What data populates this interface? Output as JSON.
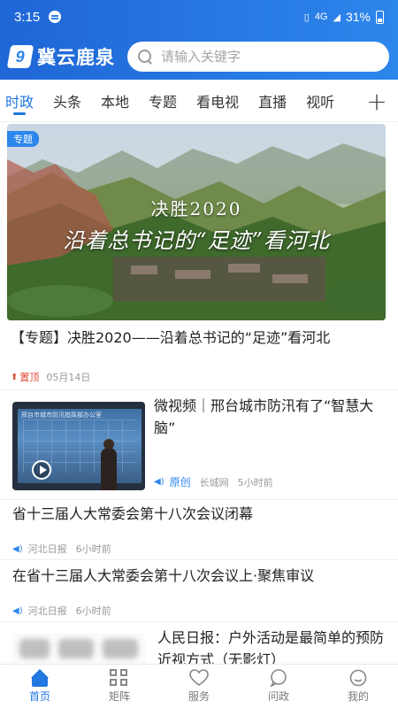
{
  "status_bar": {
    "time": "3:15",
    "network": "4G",
    "battery": "31%"
  },
  "header": {
    "logo_glyph": "9",
    "brand": "冀云鹿泉",
    "search_placeholder": "请输入关键字"
  },
  "tabs": [
    {
      "label": "时政",
      "active": true
    },
    {
      "label": "头条"
    },
    {
      "label": "本地"
    },
    {
      "label": "专题"
    },
    {
      "label": "看电视"
    },
    {
      "label": "直播"
    },
    {
      "label": "视听"
    }
  ],
  "tab_add_label": "+",
  "featured": {
    "badge": "专题",
    "overlay_line1": "决胜2020",
    "overlay_line2": "沿着总书记的“足迹”看河北",
    "title": "【专题】决胜2020——沿着总书记的“足迹”看河北",
    "pin_label": "置顶",
    "date": "05月14日"
  },
  "news": [
    {
      "title": "微视频｜邢台城市防汛有了“智慧大脑”",
      "original_label": "原创",
      "source": "长城网",
      "time": "5小时前",
      "thumb_caption": "邢台市城市防汛指挥部办公室"
    },
    {
      "title": "省十三届人大常委会第十八次会议闭幕",
      "source": "河北日报",
      "time": "6小时前"
    },
    {
      "title": "在省十三届人大常委会第十八次会议上·聚焦审议",
      "source": "河北日报",
      "time": "6小时前"
    },
    {
      "title": "人民日报：户外活动是最简单的预防近视方式（无影灯）"
    }
  ],
  "bottom_nav": [
    {
      "label": "首页",
      "icon": "home-icon",
      "active": true
    },
    {
      "label": "矩阵",
      "icon": "grid-icon"
    },
    {
      "label": "服务",
      "icon": "heart-icon"
    },
    {
      "label": "问政",
      "icon": "chat-icon"
    },
    {
      "label": "我的",
      "icon": "face-icon"
    }
  ],
  "colors": {
    "brand_blue": "#2d86ec",
    "active_blue": "#2176e0",
    "pin_red": "#e14b3b"
  }
}
